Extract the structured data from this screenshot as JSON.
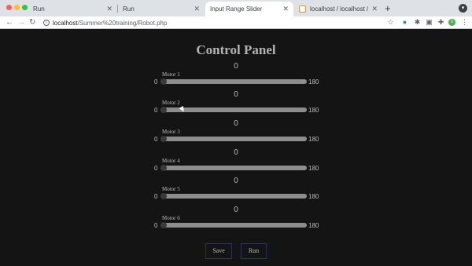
{
  "browser": {
    "tabs": [
      {
        "label": "Run",
        "active": false
      },
      {
        "label": "Run",
        "active": false
      },
      {
        "label": "Input Range Slider",
        "active": true
      },
      {
        "label": "localhost / localhost / Motors |",
        "active": false
      }
    ],
    "new_tab": "+",
    "url_host": "localhost",
    "url_path": "/Summer%20training/Robot.php",
    "profile_initial": "s"
  },
  "page": {
    "title": "Control Panel",
    "motors": [
      {
        "label": "Motor 1",
        "value": "0",
        "min": "0",
        "max": "180"
      },
      {
        "label": "Motor 2",
        "value": "0",
        "min": "0",
        "max": "180"
      },
      {
        "label": "Motor 3",
        "value": "0",
        "min": "0",
        "max": "180"
      },
      {
        "label": "Motor 4",
        "value": "0",
        "min": "0",
        "max": "180"
      },
      {
        "label": "Motor 5",
        "value": "0",
        "min": "0",
        "max": "180"
      },
      {
        "label": "Motor 6",
        "value": "0",
        "min": "0",
        "max": "180"
      }
    ],
    "buttons": {
      "save": "Save",
      "run": "Run"
    }
  },
  "colors": {
    "page_bg": "#141414",
    "track": "#8d8d8d",
    "button_border": "#2f2f5a"
  }
}
